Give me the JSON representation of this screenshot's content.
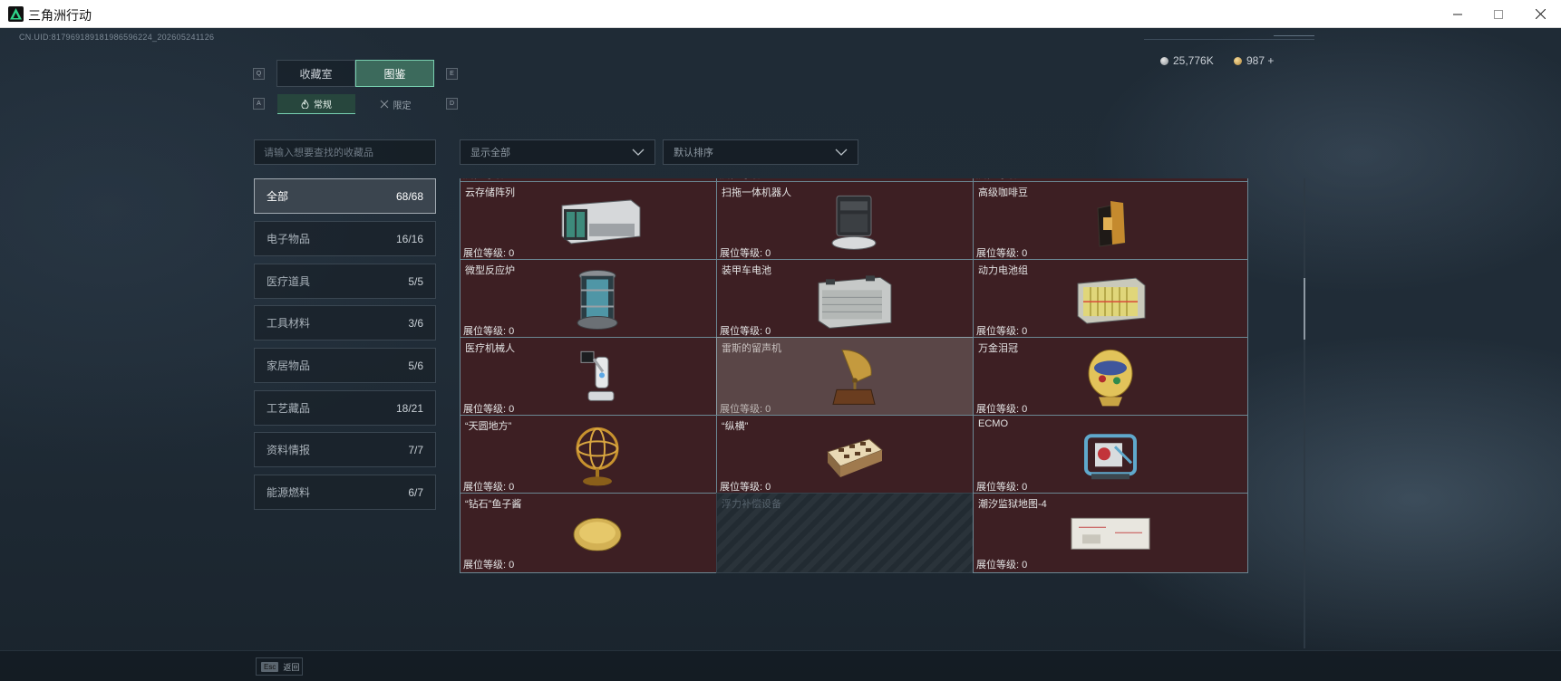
{
  "window": {
    "title": "三角洲行动"
  },
  "hud": {
    "uid": "CN.UID:817969189181986596224_202605241126",
    "currency": [
      {
        "icon": "silver-coin-icon",
        "value": "25,776K"
      },
      {
        "icon": "gold-coin-icon",
        "value": "987 +"
      }
    ]
  },
  "tabs": {
    "left_key": "Q",
    "right_key": "E",
    "items": [
      {
        "label": "收藏室",
        "active": false
      },
      {
        "label": "图鉴",
        "active": true
      }
    ]
  },
  "subtabs": {
    "left_key": "A",
    "right_key": "D",
    "items": [
      {
        "label": "常规",
        "icon": "flame-icon",
        "active": true
      },
      {
        "label": "限定",
        "icon": "crossed-swords-icon",
        "active": false
      }
    ]
  },
  "search": {
    "placeholder": "请输入想要查找的收藏品"
  },
  "filters": {
    "display": "显示全部",
    "sort": "默认排序"
  },
  "categories": [
    {
      "label": "全部",
      "count": "68/68",
      "active": true
    },
    {
      "label": "电子物品",
      "count": "16/16"
    },
    {
      "label": "医疗道具",
      "count": "5/5"
    },
    {
      "label": "工具材料",
      "count": "3/6"
    },
    {
      "label": "家居物品",
      "count": "5/6"
    },
    {
      "label": "工艺藏品",
      "count": "18/21"
    },
    {
      "label": "资料情报",
      "count": "7/7"
    },
    {
      "label": "能源燃料",
      "count": "6/7"
    }
  ],
  "collection": {
    "level_label": "展位等级: 0",
    "items": [
      {
        "name": "",
        "art": "jerrycan"
      },
      {
        "name": "",
        "art": "register"
      },
      {
        "name": "",
        "art": "vacuum"
      },
      {
        "name": "云存储阵列",
        "art": "storage"
      },
      {
        "name": "扫拖一体机器人",
        "art": "robotvac"
      },
      {
        "name": "高级咖啡豆",
        "art": "coffee"
      },
      {
        "name": "微型反应炉",
        "art": "reactor"
      },
      {
        "name": "装甲车电池",
        "art": "battery"
      },
      {
        "name": "动力电池组",
        "art": "powercell"
      },
      {
        "name": "医疗机械人",
        "art": "medrobot"
      },
      {
        "name": "雷斯的留声机",
        "art": "gramophone",
        "state": "hover"
      },
      {
        "name": "万金泪冠",
        "art": "egg"
      },
      {
        "name": "“天圆地方”",
        "art": "globe"
      },
      {
        "name": "“纵横”",
        "art": "chess"
      },
      {
        "name": "ECMO",
        "art": "ecmo"
      },
      {
        "name": "“钻石”鱼子酱",
        "art": "caviar"
      },
      {
        "name": "浮力补偿设备",
        "art": "none",
        "state": "locked"
      },
      {
        "name": "潮汐监狱地图-4",
        "art": "map"
      }
    ]
  },
  "footer": {
    "key": "Esc",
    "label": "返回"
  }
}
